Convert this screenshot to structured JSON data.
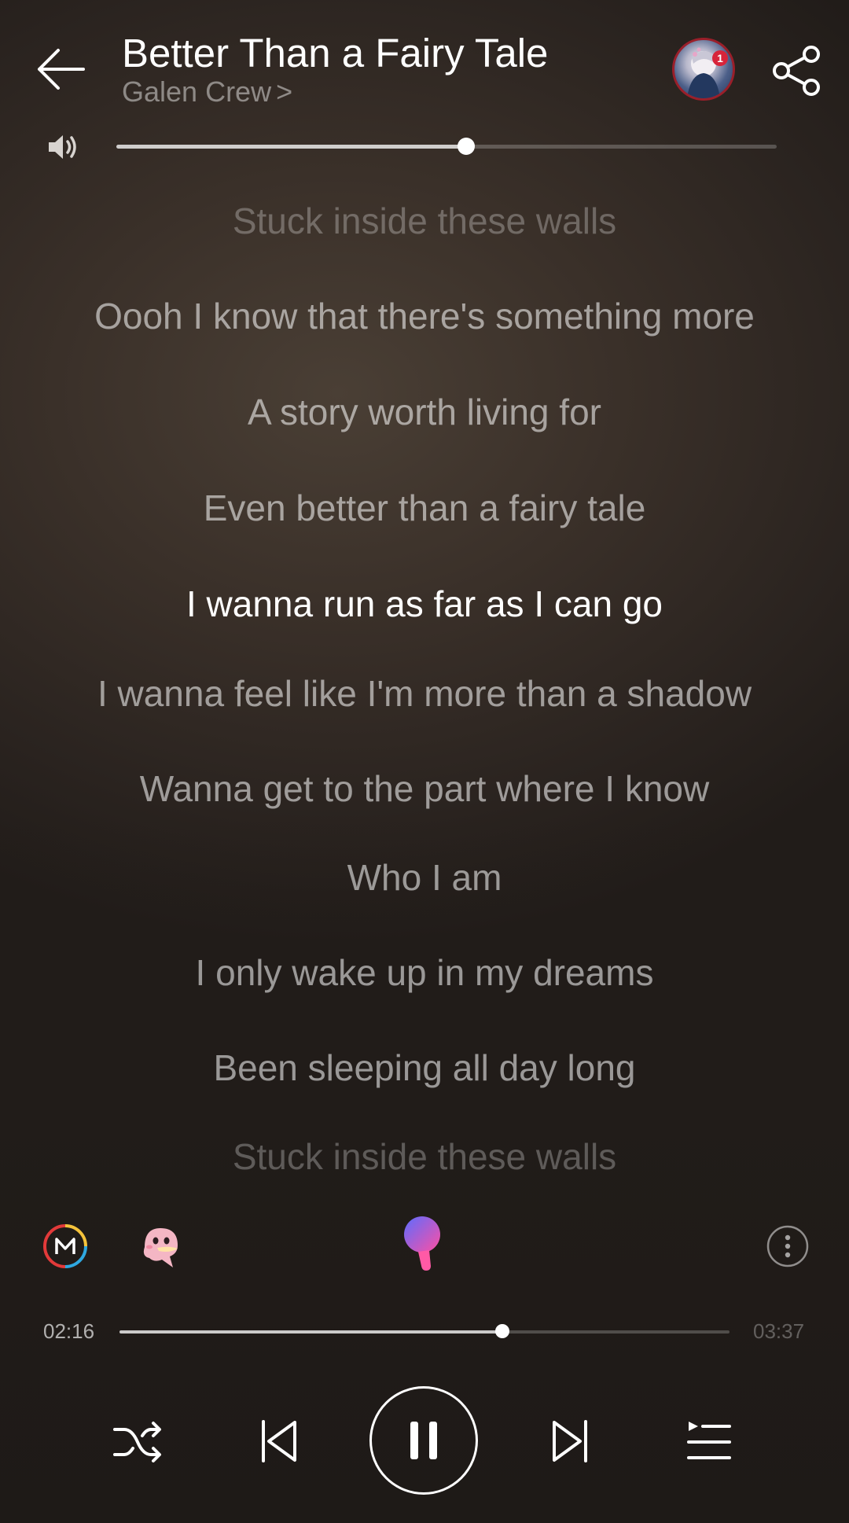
{
  "header": {
    "title": "Better Than a Fairy Tale",
    "artist": "Galen Crew",
    "artist_chevron": ">",
    "avatar_badge": "1",
    "icons": [
      "back-arrow-icon",
      "avatar-image",
      "share-icon"
    ]
  },
  "volume": {
    "icon": "speaker-icon",
    "level_percent": 53
  },
  "lyrics": [
    {
      "text": "Stuck inside these walls",
      "state": "faint"
    },
    {
      "text": "Oooh I know that there's something more",
      "state": "normal"
    },
    {
      "text": "A story worth living for",
      "state": "normal"
    },
    {
      "text": "Even better than a fairy tale",
      "state": "normal"
    },
    {
      "text": "I wanna run as far as I can go",
      "state": "active"
    },
    {
      "text": "I wanna feel like I'm more than a shadow",
      "state": "normal"
    },
    {
      "text": "Wanna get to the part where I know",
      "state": "normal"
    },
    {
      "text": "Who I am",
      "state": "normal"
    },
    {
      "text": "I only wake up in my dreams",
      "state": "normal"
    },
    {
      "text": "Been sleeping all day long",
      "state": "normal"
    },
    {
      "text": "Stuck inside these walls",
      "state": "faint"
    }
  ],
  "tools": {
    "icons": [
      "mv-icon",
      "ghost-mascot-icon",
      "karaoke-mic-icon",
      "more-options-icon"
    ]
  },
  "progress": {
    "current": "02:16",
    "duration": "03:37",
    "fraction": 0.627
  },
  "controls": {
    "icons": [
      "shuffle-icon",
      "previous-icon",
      "pause-icon",
      "next-icon",
      "playlist-icon"
    ],
    "state": "playing"
  },
  "colors": {
    "accent_ring": "#9a1f2a",
    "badge": "#d7243a",
    "mic_gradient_top": "#5c6cff",
    "mic_gradient_bottom": "#ff4fa3",
    "mv_yellow": "#f5c33b",
    "mv_red": "#e23a3a",
    "mv_blue": "#2fa8e0"
  }
}
